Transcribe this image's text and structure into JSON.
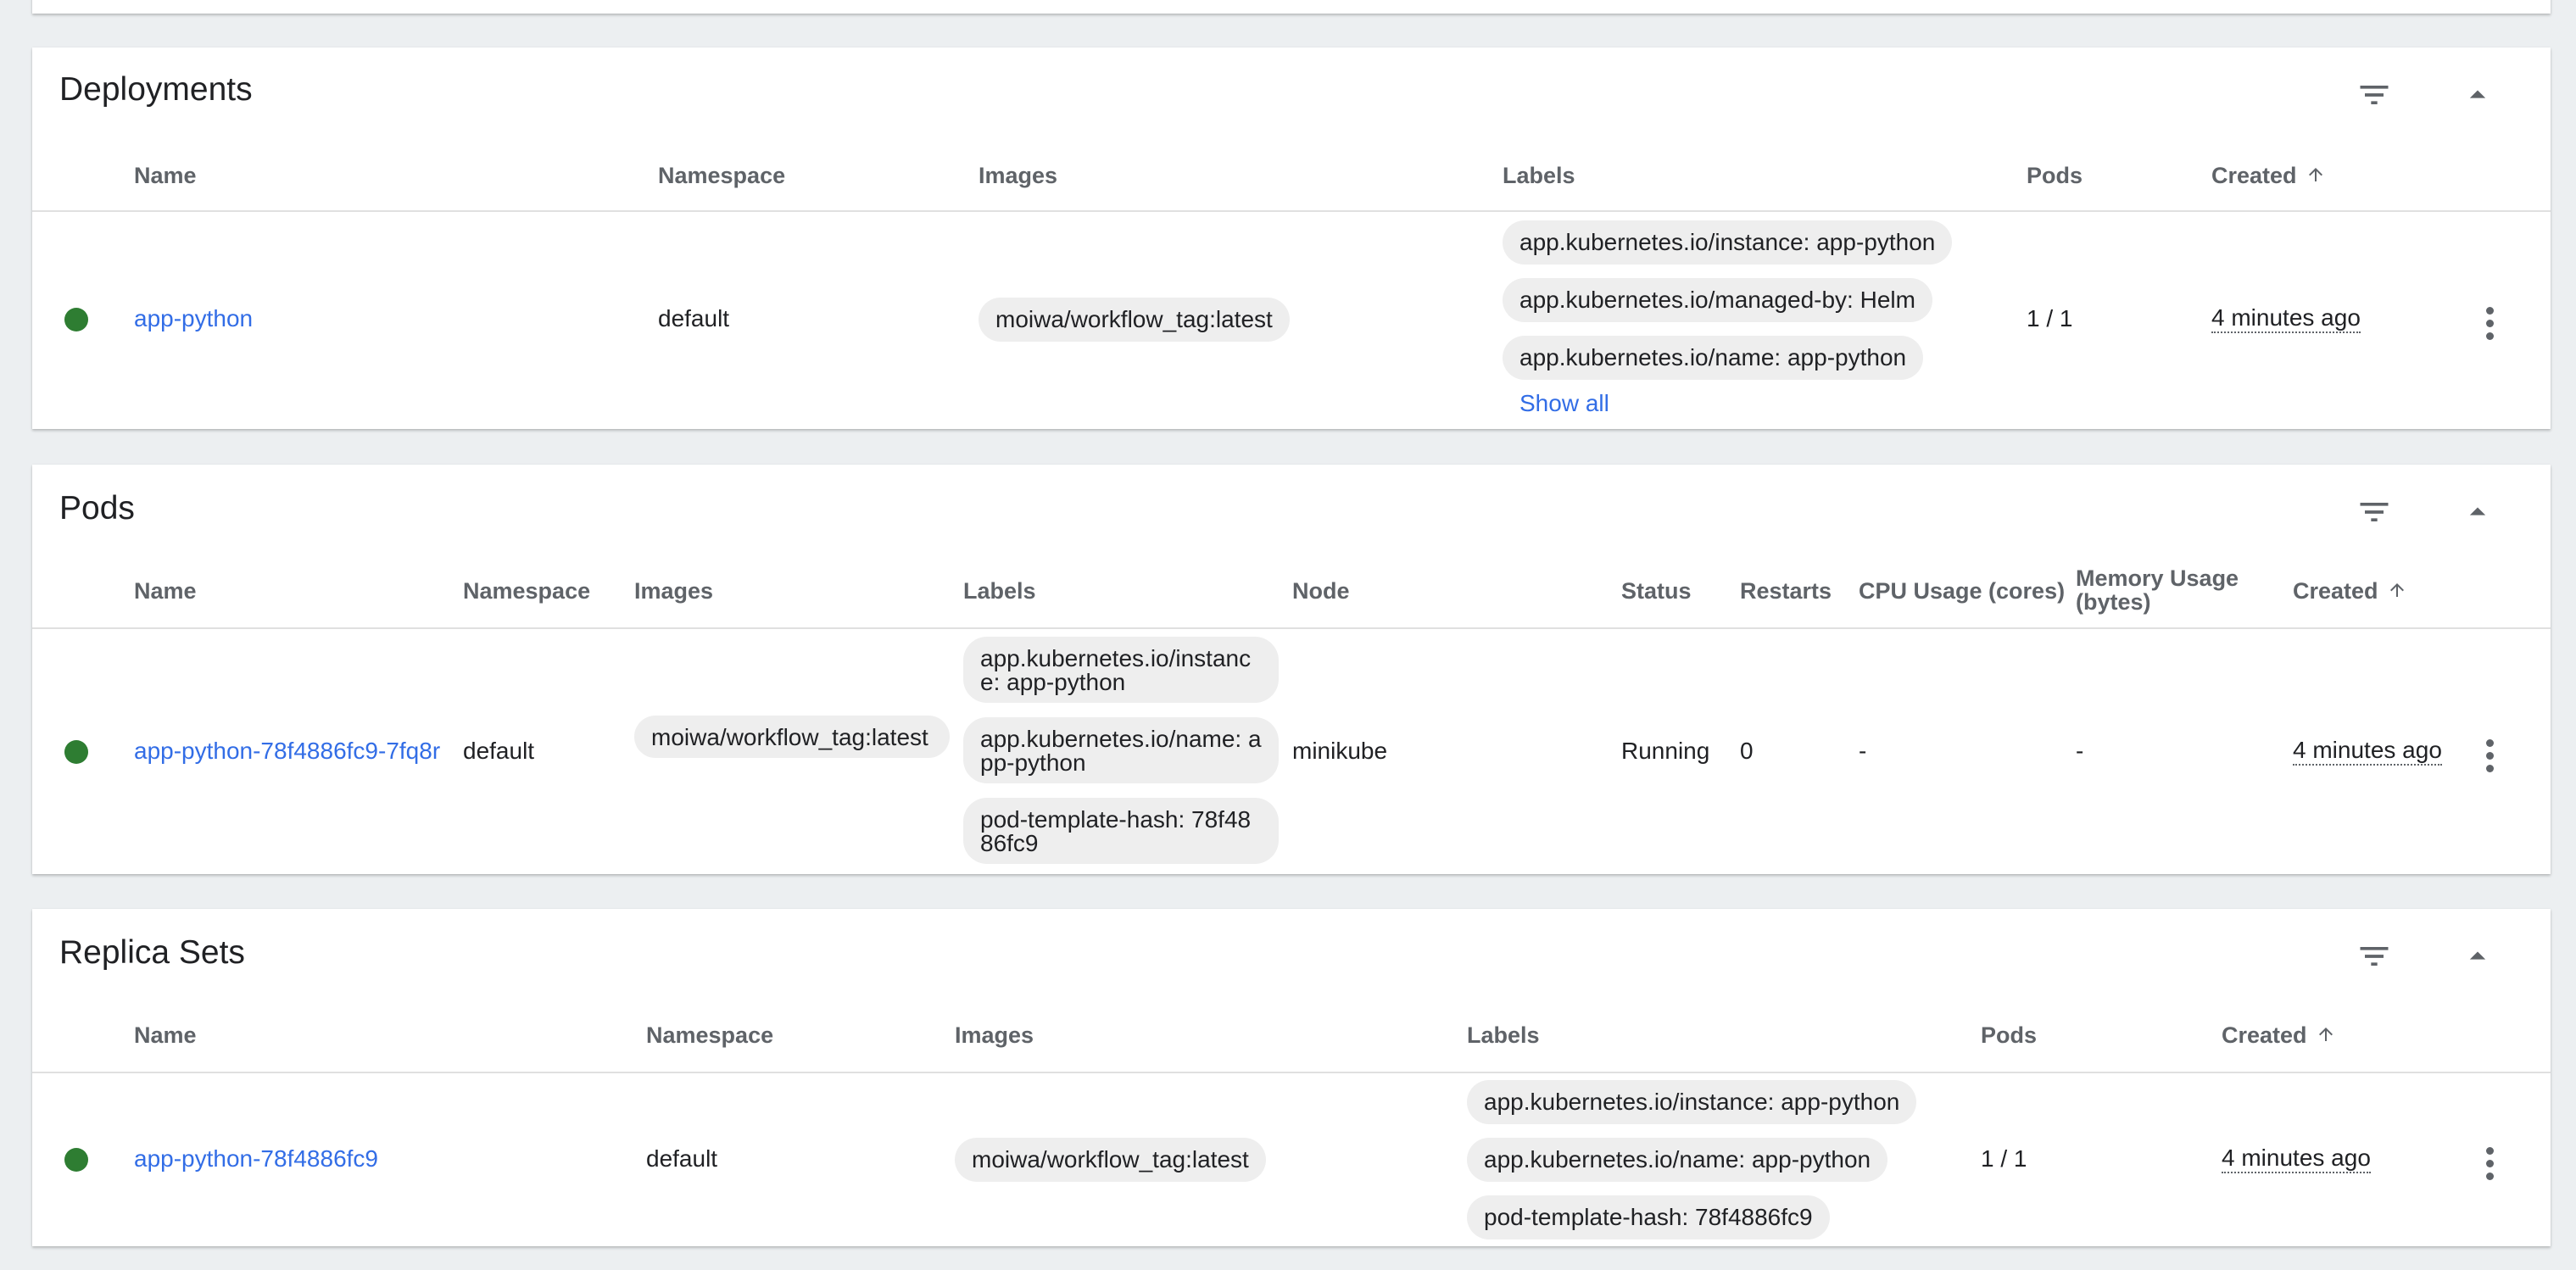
{
  "deployments": {
    "title": "Deployments",
    "headers": {
      "name": "Name",
      "namespace": "Namespace",
      "images": "Images",
      "labels": "Labels",
      "pods": "Pods",
      "created": "Created"
    },
    "row": {
      "status_color": "#2e7d32",
      "name": "app-python",
      "namespace": "default",
      "image": "moiwa/workflow_tag:latest",
      "labels": [
        "app.kubernetes.io/instance: app-python",
        "app.kubernetes.io/managed-by: Helm",
        "app.kubernetes.io/name: app-python"
      ],
      "show_all": "Show all",
      "pods": "1 / 1",
      "created": "4 minutes ago"
    }
  },
  "pods": {
    "title": "Pods",
    "headers": {
      "name": "Name",
      "namespace": "Namespace",
      "images": "Images",
      "labels": "Labels",
      "node": "Node",
      "status": "Status",
      "restarts": "Restarts",
      "cpu": "CPU Usage (cores)",
      "memory": "Memory Usage (bytes)",
      "created": "Created"
    },
    "row": {
      "status_color": "#2e7d32",
      "name": "app-python-78f4886fc9-7fq8r",
      "namespace": "default",
      "image": "moiwa/workflow_tag:latest",
      "labels": [
        "app.kubernetes.io/instance: app-python",
        "app.kubernetes.io/name: app-python",
        "pod-template-hash: 78f4886fc9"
      ],
      "node": "minikube",
      "status": "Running",
      "restarts": "0",
      "cpu": "-",
      "memory": "-",
      "created": "4 minutes ago"
    }
  },
  "replica_sets": {
    "title": "Replica Sets",
    "headers": {
      "name": "Name",
      "namespace": "Namespace",
      "images": "Images",
      "labels": "Labels",
      "pods": "Pods",
      "created": "Created"
    },
    "row": {
      "status_color": "#2e7d32",
      "name": "app-python-78f4886fc9",
      "namespace": "default",
      "image": "moiwa/workflow_tag:latest",
      "labels": [
        "app.kubernetes.io/instance: app-python",
        "app.kubernetes.io/name: app-python",
        "pod-template-hash: 78f4886fc9"
      ],
      "pods": "1 / 1",
      "created": "4 minutes ago"
    }
  },
  "icons": {
    "filter": "filter-icon",
    "collapse": "chevron-up-icon",
    "sort": "arrow-up-icon",
    "more": "more-vert-icon"
  },
  "colors": {
    "accent": "#326de6",
    "success": "#2e7d32",
    "chip_bg": "#eeeeee",
    "page_bg": "#eceff1"
  }
}
